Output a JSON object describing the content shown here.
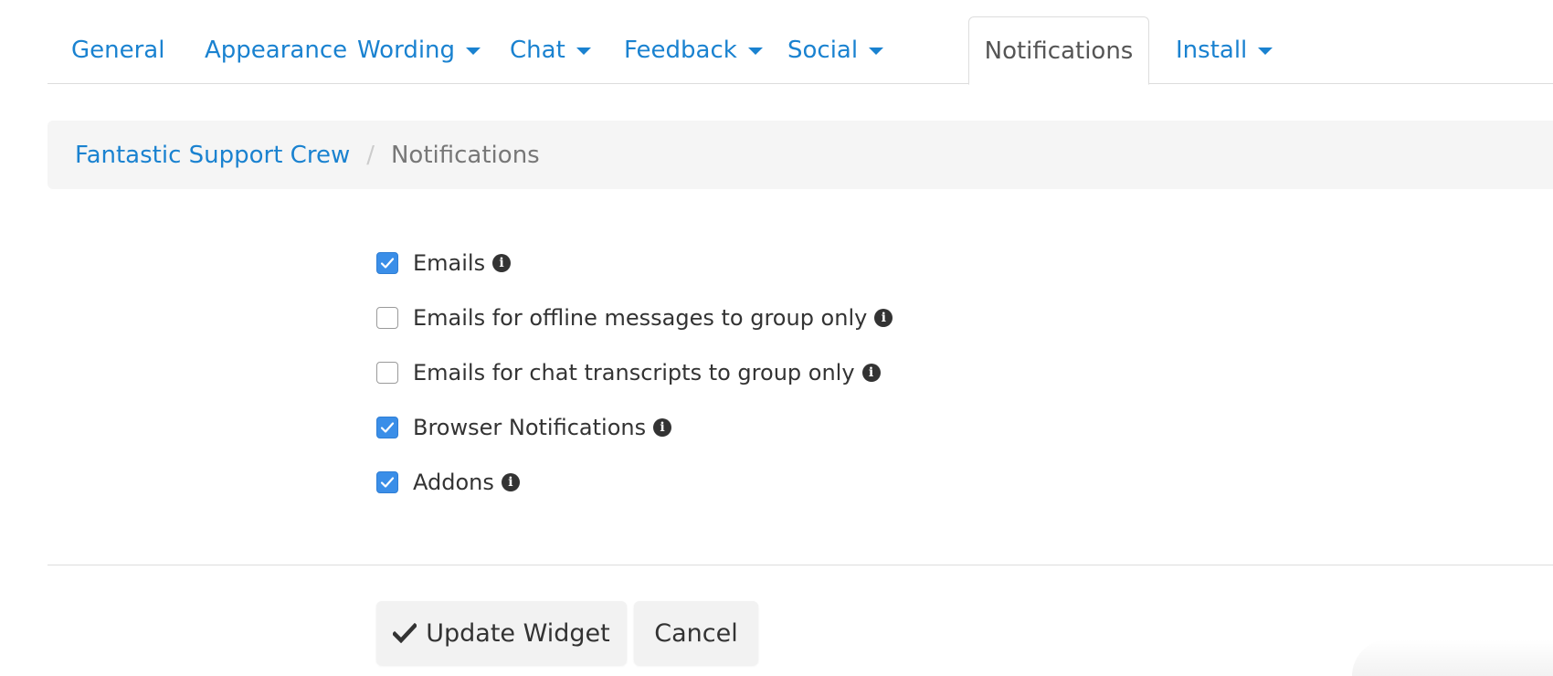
{
  "tabs": [
    {
      "label": "General",
      "dropdown": false,
      "active": false
    },
    {
      "label": "Appearance",
      "dropdown": false,
      "active": false
    },
    {
      "label": "Wording",
      "dropdown": true,
      "active": false
    },
    {
      "label": "Chat",
      "dropdown": true,
      "active": false
    },
    {
      "label": "Feedback",
      "dropdown": true,
      "active": false
    },
    {
      "label": "Social",
      "dropdown": true,
      "active": false
    },
    {
      "label": "Notifications",
      "dropdown": false,
      "active": true
    },
    {
      "label": "Install",
      "dropdown": true,
      "active": false
    }
  ],
  "breadcrumb": {
    "parent": "Fantastic Support Crew",
    "separator": "/",
    "current": "Notifications"
  },
  "options": [
    {
      "label": "Emails",
      "checked": true,
      "icon": "info-icon"
    },
    {
      "label": "Emails for offline messages to group only",
      "checked": false,
      "icon": "info-icon"
    },
    {
      "label": "Emails for chat transcripts to group only",
      "checked": false,
      "icon": "info-icon"
    },
    {
      "label": "Browser Notifications",
      "checked": true,
      "icon": "info-icon"
    },
    {
      "label": "Addons",
      "checked": true,
      "icon": "info-icon"
    }
  ],
  "actions": {
    "update_label": "Update Widget",
    "update_icon": "check-icon",
    "cancel_label": "Cancel"
  },
  "colors": {
    "link": "#1a82d0",
    "checkbox_checked": "#3a8ee8",
    "breadcrumb_bg": "#f5f5f5",
    "button_bg": "#f2f2f2"
  }
}
